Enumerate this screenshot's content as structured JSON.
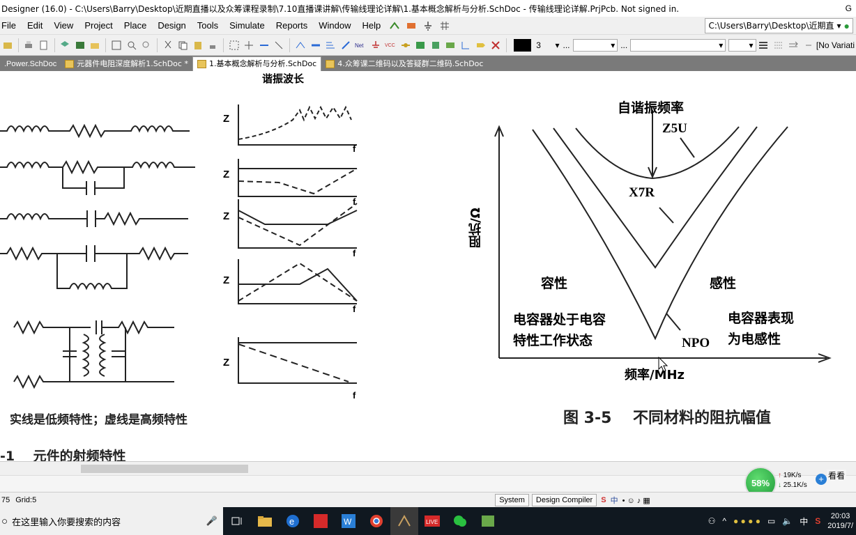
{
  "window": {
    "title": "Designer (16.0) - C:\\Users\\Barry\\Desktop\\近期直播以及众筹课程录制\\7.10直播课讲解\\传输线理论详解\\1.基本概念解析与分析.SchDoc - 传输线理论详解.PrjPcb. Not signed in.",
    "corner": "G"
  },
  "menu": {
    "items": [
      "File",
      "Edit",
      "View",
      "Project",
      "Place",
      "Design",
      "Tools",
      "Simulate",
      "Reports",
      "Window",
      "Help"
    ],
    "path": "C:\\Users\\Barry\\Desktop\\近期直"
  },
  "toolbar": {
    "line_width": "3",
    "ellipsis": "...",
    "variations": "[No Variati"
  },
  "tabs": [
    {
      "label": ".Power.SchDoc",
      "active": false
    },
    {
      "label": "元器件电阻深度解析1.SchDoc *",
      "active": false
    },
    {
      "label": "1.基本概念解析与分析.SchDoc",
      "active": true
    },
    {
      "label": "4.众筹课二维码以及答疑群二维码.SchDoc",
      "active": false
    }
  ],
  "document": {
    "left_figure": {
      "top_label": "谐振波长",
      "z_label": "Z",
      "f_label": "f",
      "caption_note": "实线是低频特性；虚线是高频特性",
      "caption_title": "-1    元件的射频特性"
    },
    "right_figure": {
      "resonance_label": "自谐振频率",
      "z5u": "Z5U",
      "x7r": "X7R",
      "npo": "NPO",
      "y_axis": "阻抗/Ω",
      "x_axis": "频率/MHz",
      "capacitive": "容性",
      "inductive": "感性",
      "cap_state_line1": "电容器处于电容",
      "cap_state_line2": "特性工作状态",
      "ind_state_line1": "电容器表现",
      "ind_state_line2": "为电感性",
      "caption": "图 3-5    不同材料的阻抗幅值"
    }
  },
  "status": {
    "coords": "75",
    "grid": "Grid:5",
    "panels": [
      "System",
      "Design Compiler"
    ]
  },
  "netspeed": {
    "percent": "58%",
    "up": "19K/s",
    "down": "25.1K/s",
    "look": "看看"
  },
  "taskbar": {
    "search_placeholder": "在这里输入你要搜索的内容",
    "ime": "中",
    "time": "20:03",
    "date": "2019/7/"
  }
}
